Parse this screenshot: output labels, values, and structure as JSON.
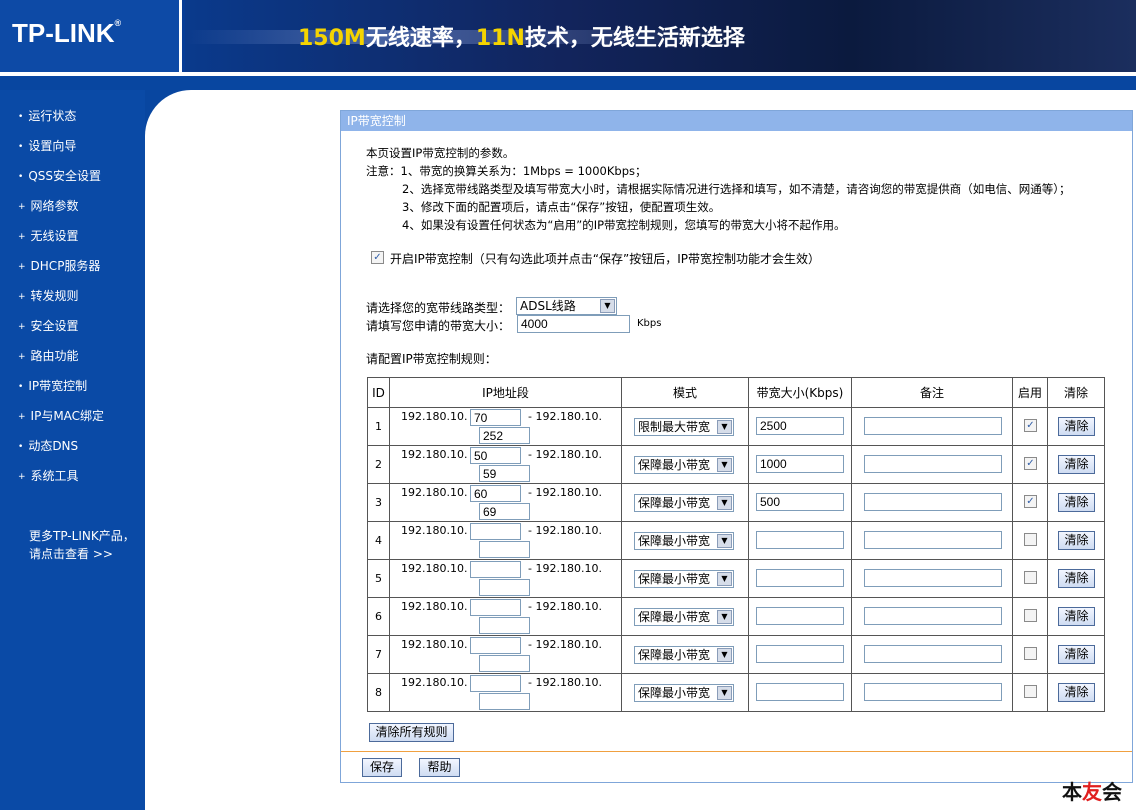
{
  "header": {
    "logo": "TP-LINK",
    "logo_mark": "®",
    "slogan_part1": "150M",
    "slogan_part2": "无线速率，",
    "slogan_part3": "11N",
    "slogan_part4": "技术，无线生活新选择"
  },
  "sidebar": {
    "items": [
      {
        "label": "运行状态"
      },
      {
        "label": "设置向导"
      },
      {
        "label": "QSS安全设置"
      },
      {
        "label": "网络参数"
      },
      {
        "label": "无线设置"
      },
      {
        "label": "DHCP服务器"
      },
      {
        "label": "转发规则"
      },
      {
        "label": "安全设置"
      },
      {
        "label": "路由功能"
      },
      {
        "label": "IP带宽控制"
      },
      {
        "label": "IP与MAC绑定"
      },
      {
        "label": "动态DNS"
      },
      {
        "label": "系统工具"
      }
    ],
    "more_line1": "更多TP-LINK产品，",
    "more_line2": "请点击查看 >>"
  },
  "panel": {
    "title": "IP带宽控制",
    "intro": "本页设置IP带宽控制的参数。",
    "note1": "注意：1、带宽的换算关系为：1Mbps = 1000Kbps；",
    "note2": "2、选择宽带线路类型及填写带宽大小时，请根据实际情况进行选择和填写，如不清楚，请咨询您的带宽提供商（如电信、网通等）；",
    "note3": "3、修改下面的配置项后，请点击“保存”按钮，使配置项生效。",
    "note4": "4、如果没有设置任何状态为“启用”的IP带宽控制规则，您填写的带宽大小将不起作用。",
    "enable_checked": true,
    "enable_label": "开启IP带宽控制（只有勾选此项并点击“保存”按钮后，IP带宽控制功能才会生效）",
    "line_type_label": "请选择您的宽带线路类型：",
    "line_type_value": "ADSL线路",
    "bandwidth_label": "请填写您申请的带宽大小：",
    "bandwidth_value": "4000",
    "bandwidth_unit": "Kbps",
    "rules_label": "请配置IP带宽控制规则：",
    "table_headers": [
      "ID",
      "IP地址段",
      "模式",
      "带宽大小(Kbps)",
      "备注",
      "启用",
      "清除"
    ],
    "ip_prefix": "192.180.10.",
    "ip_sep": "- 192.180.10.",
    "clear_label": "清除",
    "rules": [
      {
        "id": "1",
        "start": "70",
        "end": "252",
        "mode": "限制最大带宽",
        "bw": "2500",
        "note": "",
        "enabled": true
      },
      {
        "id": "2",
        "start": "50",
        "end": "59",
        "mode": "保障最小带宽",
        "bw": "1000",
        "note": "",
        "enabled": true
      },
      {
        "id": "3",
        "start": "60",
        "end": "69",
        "mode": "保障最小带宽",
        "bw": "500",
        "note": "",
        "enabled": true
      },
      {
        "id": "4",
        "start": "",
        "end": "",
        "mode": "保障最小带宽",
        "bw": "",
        "note": "",
        "enabled": false
      },
      {
        "id": "5",
        "start": "",
        "end": "",
        "mode": "保障最小带宽",
        "bw": "",
        "note": "",
        "enabled": false
      },
      {
        "id": "6",
        "start": "",
        "end": "",
        "mode": "保障最小带宽",
        "bw": "",
        "note": "",
        "enabled": false
      },
      {
        "id": "7",
        "start": "",
        "end": "",
        "mode": "保障最小带宽",
        "bw": "",
        "note": "",
        "enabled": false
      },
      {
        "id": "8",
        "start": "",
        "end": "",
        "mode": "保障最小带宽",
        "bw": "",
        "note": "",
        "enabled": false
      }
    ],
    "clear_all_label": "清除所有规则",
    "save_label": "保存",
    "help_label": "帮助"
  },
  "watermark": {
    "part1": "本",
    "part2": "友",
    "part3": "会"
  },
  "colors": {
    "header_bg": "#063c96",
    "sidebar_bg": "#0a4aa6",
    "panel_title_bg": "#8fb4ea",
    "slogan_highlight": "#f5d400"
  }
}
